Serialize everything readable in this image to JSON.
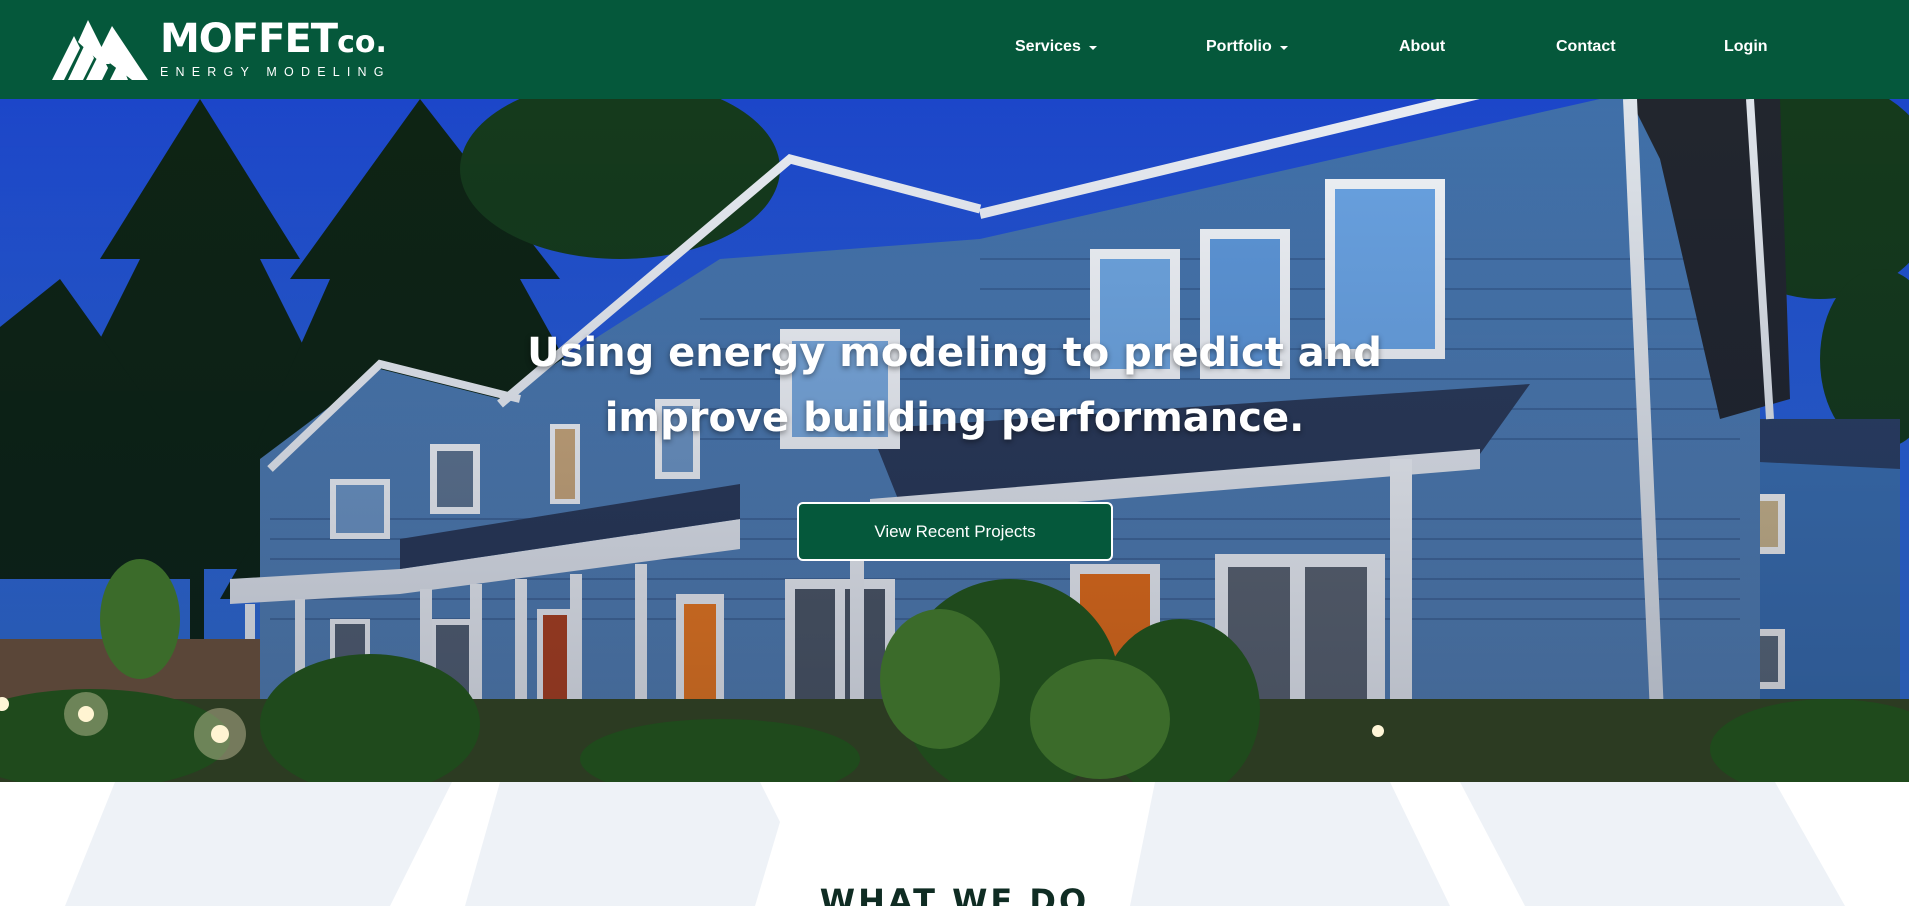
{
  "brand": {
    "name": "MOFFET",
    "name_suffix": "co.",
    "tagline": "ENERGY MODELING"
  },
  "nav": {
    "services": "Services",
    "portfolio": "Portfolio",
    "about": "About",
    "contact": "Contact",
    "login": "Login"
  },
  "hero": {
    "title_line1": "Using energy modeling to predict and",
    "title_line2": "improve building performance.",
    "cta": "View Recent Projects"
  },
  "section": {
    "title": "WHAT WE DO"
  },
  "colors": {
    "brand_green": "#05583b",
    "white": "#ffffff",
    "pattern": "#eef2f7",
    "title_dark": "#0f2c23"
  }
}
